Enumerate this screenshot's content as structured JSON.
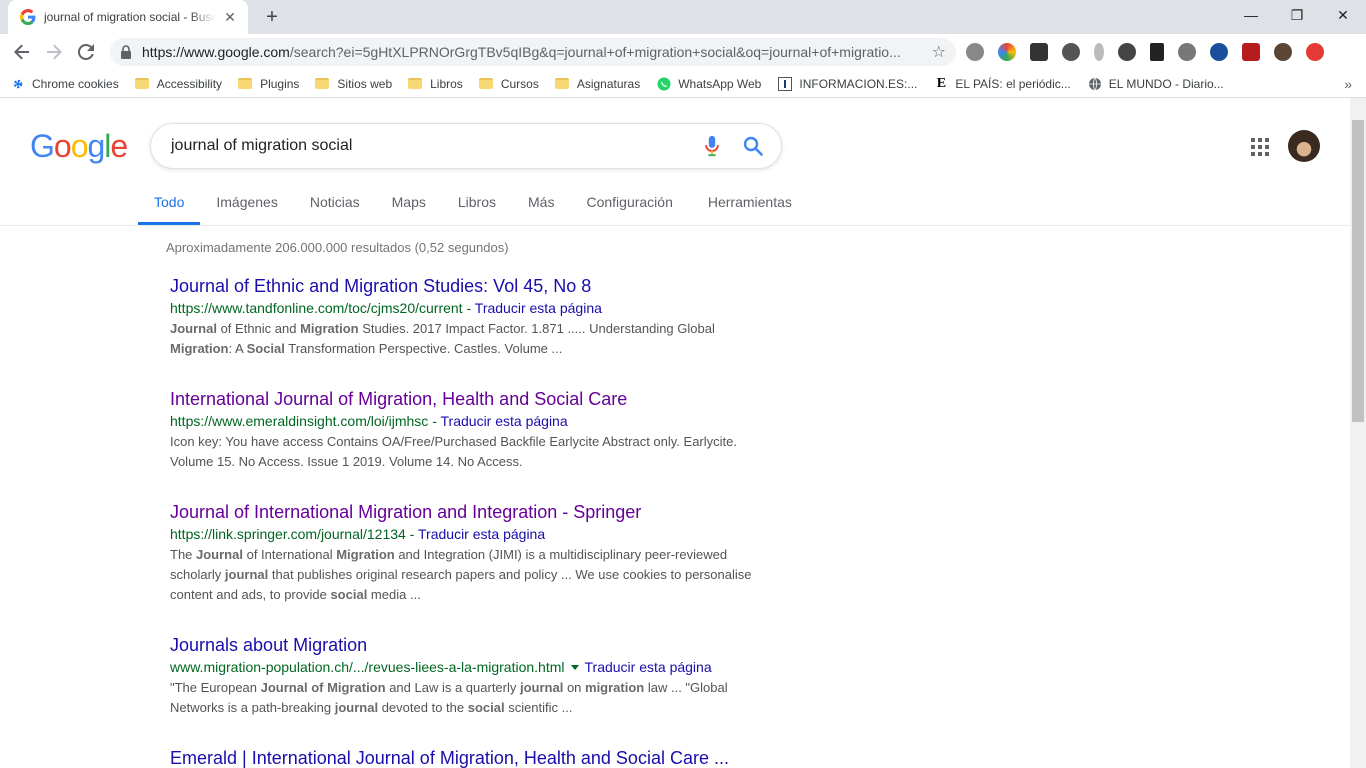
{
  "browser": {
    "tab_title": "journal of migration social - Buscar con Google",
    "tab_close": "✕",
    "new_tab": "+",
    "window": {
      "minimize": "—",
      "restore": "❐",
      "close": "✕"
    },
    "url": "https://www.google.com/search?ei=5gHtXLPRNOrGrgTBv5qIBg&q=journal+of+migration+social&oq=journal+of+migratio...",
    "url_host": "https://www.google.com",
    "url_path": "/search?ei=5gHtXLPRNOrGrgTBv5qIBg&q=journal+of+migration+social&oq=journal+of+migratio..."
  },
  "bookmarks": [
    {
      "label": "Chrome cookies",
      "icon": "gear-icon"
    },
    {
      "label": "Accessibility",
      "icon": "folder-icon"
    },
    {
      "label": "Plugins",
      "icon": "folder-icon"
    },
    {
      "label": "Sitios web",
      "icon": "folder-icon"
    },
    {
      "label": "Libros",
      "icon": "folder-icon"
    },
    {
      "label": "Cursos",
      "icon": "folder-icon"
    },
    {
      "label": "Asignaturas",
      "icon": "folder-icon"
    },
    {
      "label": "WhatsApp Web",
      "icon": "whatsapp-icon"
    },
    {
      "label": "INFORMACION.ES:...",
      "icon": "informacion-icon"
    },
    {
      "label": "EL PAÍS: el periódic...",
      "icon": "elpais-icon"
    },
    {
      "label": "EL MUNDO - Diario...",
      "icon": "globe-icon"
    }
  ],
  "bookmarks_more": "»",
  "search": {
    "query": "journal of migration social",
    "tabs": [
      "Todo",
      "Imágenes",
      "Noticias",
      "Maps",
      "Libros",
      "Más",
      "Configuración",
      "Herramientas"
    ],
    "active_tab": "Todo",
    "stats": "Aproximadamente 206.000.000 resultados (0,52 segundos)"
  },
  "results": [
    {
      "title": "Journal of Ethnic and Migration Studies: Vol 45, No 8",
      "url": "https://www.tandfonline.com/toc/cjms20/current",
      "translate": "Traducir esta página",
      "snippet_html": "<b>Journal</b> of Ethnic and <b>Migration</b> Studies. 2017 Impact Factor. 1.871 ..... Understanding Global <b>Migration</b>: A <b>Social</b> Transformation Perspective. Castles. Volume ..."
    },
    {
      "title": "International Journal of Migration, Health and Social Care",
      "url": "https://www.emeraldinsight.com/loi/ijmhsc",
      "translate": "Traducir esta página",
      "snippet_html": "Icon key: You have access Contains OA/Free/Purchased Backfile Earlycite Abstract only. Earlycite. Volume 15. No Access. Issue 1 2019. Volume 14. No Access."
    },
    {
      "title": "Journal of International Migration and Integration - Springer",
      "url": "https://link.springer.com/journal/12134",
      "translate": "Traducir esta página",
      "snippet_html": "The <b>Journal</b> of International <b>Migration</b> and Integration (JIMI) is a multidisciplinary peer-reviewed scholarly <b>journal</b> that publishes original research papers and policy ... We use cookies to personalise content and ads, to provide <b>social</b> media ..."
    },
    {
      "title": "Journals about Migration",
      "url": "www.migration-population.ch/.../revues-liees-a-la-migration.html",
      "translate": "Traducir esta página",
      "snippet_html": "\"The European <b>Journal of Migration</b> and Law is a quarterly <b>journal</b> on <b>migration</b> law ... \"Global Networks is a path-breaking <b>journal</b> devoted to the <b>social</b> scientific ..."
    },
    {
      "title": "Emerald | International Journal of Migration, Health and Social Care ...",
      "url": "",
      "translate": "",
      "snippet_html": ""
    }
  ],
  "colors": {
    "link": "#1a0dab",
    "visited": "#660099",
    "url_green": "#006621",
    "accent_blue": "#1a73e8"
  }
}
